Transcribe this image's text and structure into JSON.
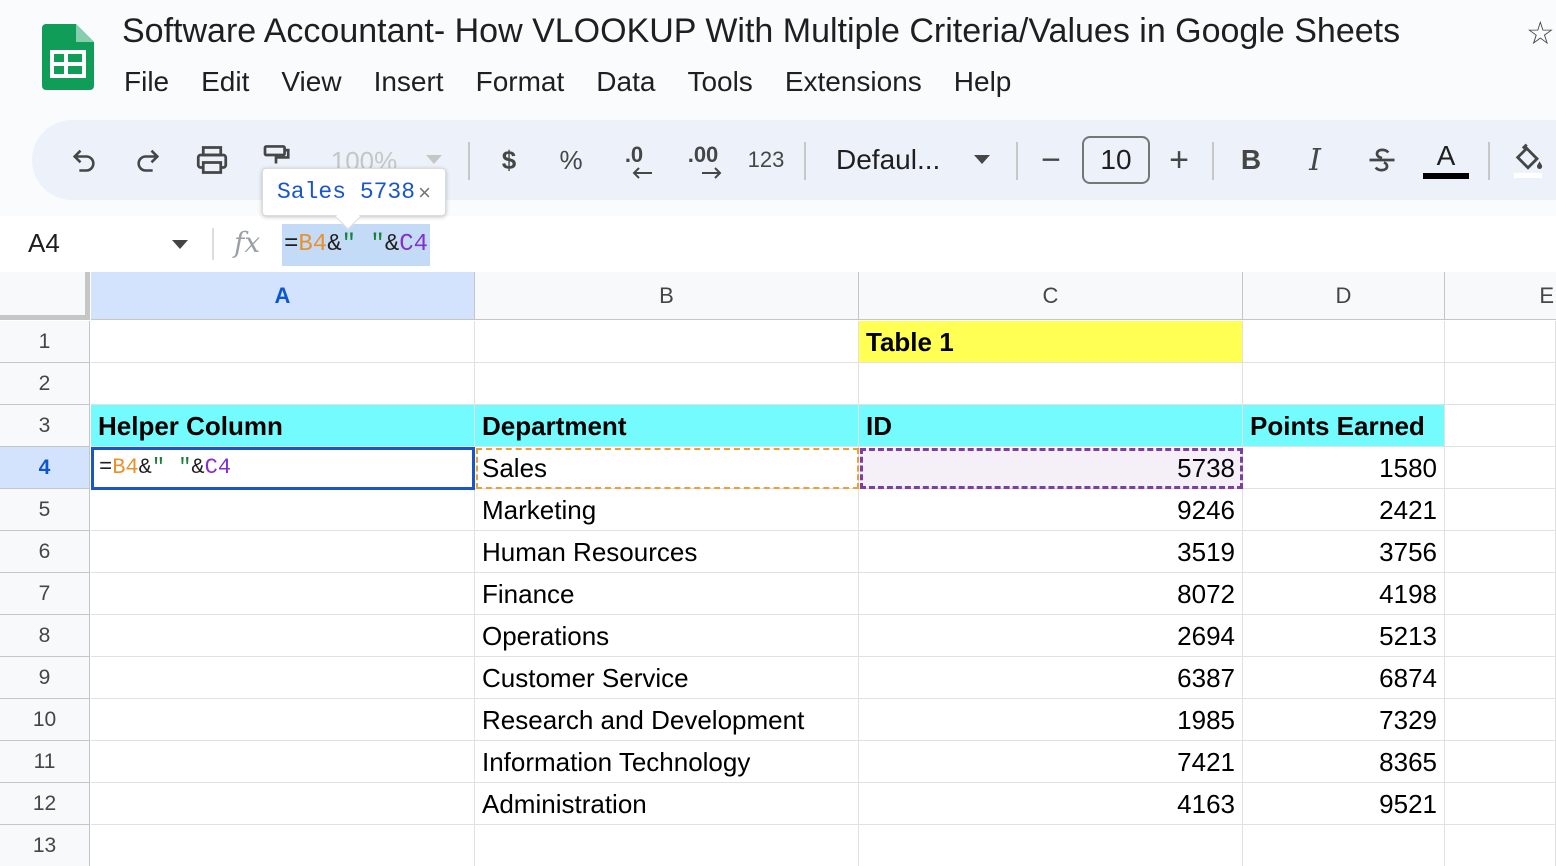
{
  "doc": {
    "title": "Software Accountant- How VLOOKUP With Multiple Criteria/Values in Google Sheets"
  },
  "menu": [
    "File",
    "Edit",
    "View",
    "Insert",
    "Format",
    "Data",
    "Tools",
    "Extensions",
    "Help"
  ],
  "toolbar": {
    "zoom": "100%",
    "currency": "$",
    "percent": "%",
    "decrease_decimal": ".0",
    "increase_decimal": ".00",
    "number_format": "123",
    "font": "Defaul...",
    "minus": "−",
    "font_size": "10",
    "plus": "+",
    "bold": "B",
    "italic": "I",
    "text_color_letter": "A",
    "text_color_bar": "#000000"
  },
  "formula_bar": {
    "cell_ref": "A4",
    "formula": "=B4&\" \"&C4",
    "formula_parts": [
      "=",
      "B4",
      "&",
      "\" \"",
      "&",
      "C4"
    ]
  },
  "tooltip": {
    "preview": "Sales 5738",
    "close": "×"
  },
  "grid": {
    "columns": [
      "A",
      "B",
      "C",
      "D",
      "E"
    ],
    "rows": [
      "1",
      "2",
      "3",
      "4",
      "5",
      "6",
      "7",
      "8",
      "9",
      "10",
      "11",
      "12",
      "13"
    ],
    "table_title": "Table 1",
    "headers": {
      "helper": "Helper Column",
      "department": "Department",
      "id": "ID",
      "points": "Points Earned"
    },
    "active_cell_formula_parts": [
      "=",
      "B4",
      "&",
      "\" \"",
      "&",
      "C4"
    ],
    "data": [
      {
        "department": "Sales",
        "id": "5738",
        "points": "1580"
      },
      {
        "department": "Marketing",
        "id": "9246",
        "points": "2421"
      },
      {
        "department": "Human Resources",
        "id": "3519",
        "points": "3756"
      },
      {
        "department": "Finance",
        "id": "8072",
        "points": "4198"
      },
      {
        "department": "Operations",
        "id": "2694",
        "points": "5213"
      },
      {
        "department": "Customer Service",
        "id": "6387",
        "points": "6874"
      },
      {
        "department": "Research and Development",
        "id": "1985",
        "points": "7329"
      },
      {
        "department": "Information Technology",
        "id": "7421",
        "points": "8365"
      },
      {
        "department": "Administration",
        "id": "4163",
        "points": "9521"
      }
    ]
  },
  "colors": {
    "accent": "#1a56c9",
    "header_fill": "#73fbfd",
    "title_fill": "#ffff54",
    "ref_orange": "#e8912d",
    "ref_purple": "#8430ce"
  }
}
